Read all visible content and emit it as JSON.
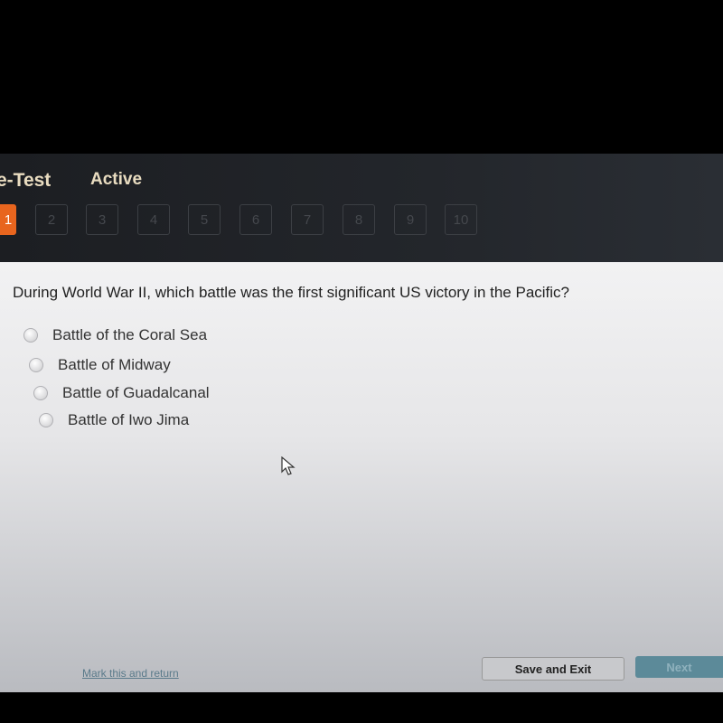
{
  "header": {
    "section_title": "e-Test",
    "status": "Active"
  },
  "question_tabs": [
    "1",
    "2",
    "3",
    "4",
    "5",
    "6",
    "7",
    "8",
    "9",
    "10"
  ],
  "active_tab": "1",
  "question": {
    "text": "During World War II, which battle was the first significant US victory in the Pacific?",
    "options": [
      "Battle of the Coral Sea",
      "Battle of Midway",
      "Battle of Guadalcanal",
      "Battle of Iwo Jima"
    ]
  },
  "footer": {
    "mark_link": "Mark this and return",
    "save_exit": "Save and Exit",
    "next": "Next"
  },
  "colors": {
    "accent": "#e8651e",
    "next_button": "#5c8a99"
  }
}
